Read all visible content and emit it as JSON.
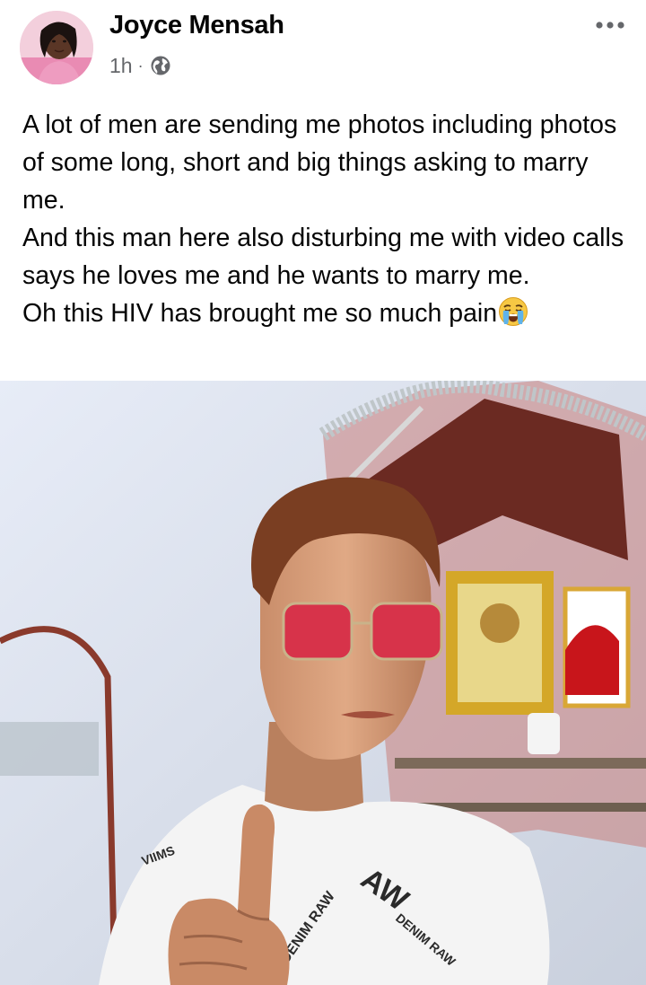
{
  "post": {
    "author": {
      "name": "Joyce Mensah",
      "avatar_icon": "profile-photo"
    },
    "timestamp": "1h",
    "separator": "·",
    "privacy_icon": "globe-icon",
    "more_icon": "more-options-icon",
    "caption_lines": [
      "A lot of men are sending me photos including photos of some long, short and big things asking to marry me.",
      "And this man here also disturbing me with video calls says he loves me and he wants to marry me.",
      "Oh this HIV has brought me so much pain"
    ],
    "caption_emoji": "loudly-crying-face-icon",
    "photo": {
      "description_icon": "selfie-photo",
      "shirt_text": "RAW DENIM"
    }
  },
  "colors": {
    "text_primary": "#050505",
    "text_secondary": "#65676b",
    "background": "#ffffff"
  }
}
